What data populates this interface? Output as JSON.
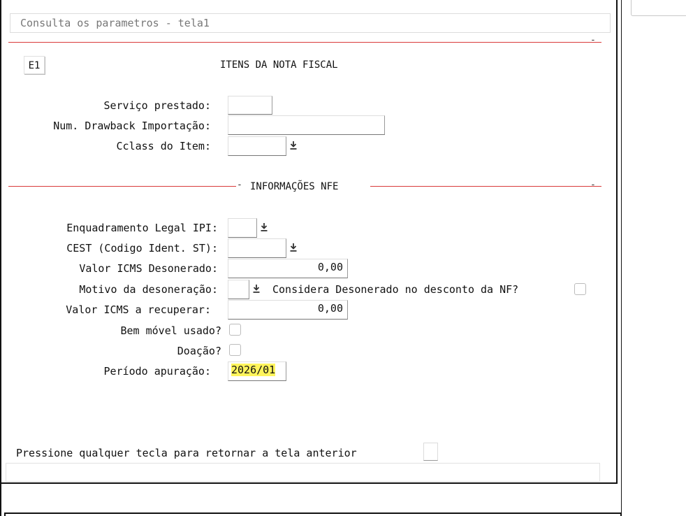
{
  "window": {
    "title": "Consulta os parametros - tela1"
  },
  "header": {
    "code": "E1",
    "section_title": "ITENS DA NOTA FISCAL"
  },
  "items": {
    "servico_label": "Serviço prestado:",
    "servico_value": "",
    "drawback_label": "Num. Drawback Importação:",
    "drawback_value": "",
    "cclass_label": "Cclass do Item:",
    "cclass_value": ""
  },
  "nfe": {
    "section_title": "INFORMAÇÕES NFE",
    "enquadramento_label": "Enquadramento Legal IPI:",
    "cest_label": "CEST (Codigo Ident. ST):",
    "icms_desonerado_label": "Valor ICMS Desonerado:",
    "icms_desonerado_value": "0,00",
    "motivo_label": "Motivo da desoneração:",
    "considera_label": "Considera Desonerado no desconto da NF?",
    "icms_recuperar_label": "Valor ICMS a recuperar:",
    "icms_recuperar_value": "0,00",
    "bem_movel_label": "Bem móvel usado?",
    "doacao_label": "Doação?",
    "periodo_label": "Período apuração:",
    "periodo_value": "2026/01"
  },
  "footer": {
    "prompt": "Pressione qualquer tecla para retornar a tela anterior"
  },
  "icons": {
    "dropdown": "download-arrow-icon",
    "dash": "-"
  },
  "colors": {
    "separator": "#d93a3a",
    "highlight": "#fff45c"
  }
}
